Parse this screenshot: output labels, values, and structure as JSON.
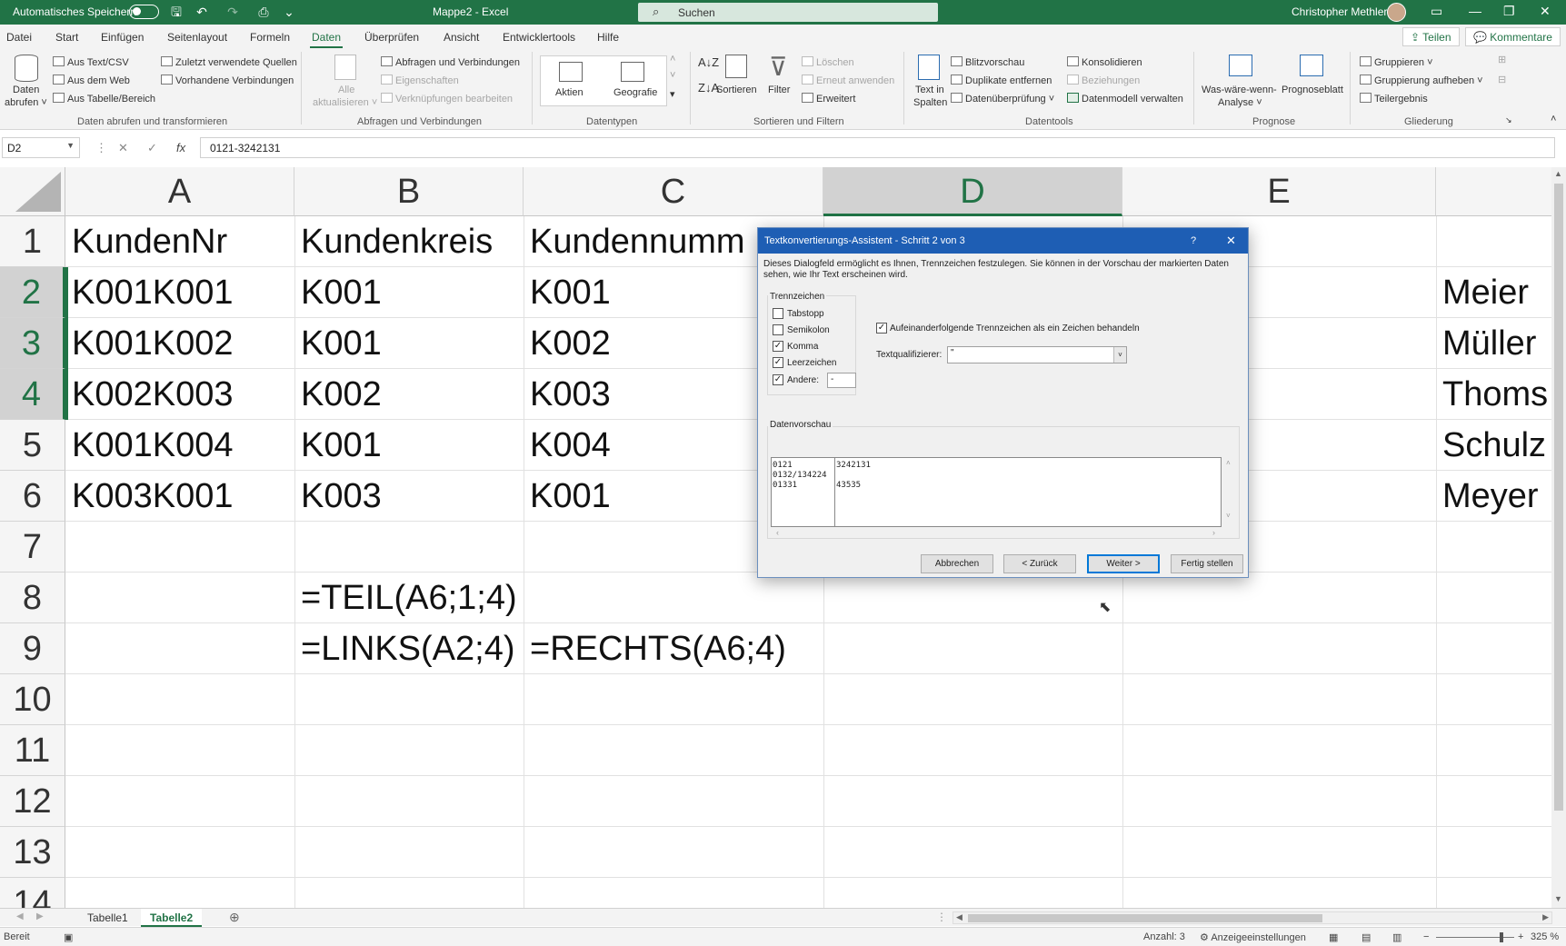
{
  "titlebar": {
    "autosave_label": "Automatisches Speichern",
    "doc_title": "Mappe2  -  Excel",
    "search_placeholder": "Suchen",
    "user": "Christopher Methler"
  },
  "menu": {
    "tabs": [
      "Datei",
      "Start",
      "Einfügen",
      "Seitenlayout",
      "Formeln",
      "Daten",
      "Überprüfen",
      "Ansicht",
      "Entwicklertools",
      "Hilfe"
    ],
    "active": "Daten",
    "share": "Teilen",
    "comments": "Kommentare"
  },
  "ribbon": {
    "get_data": {
      "btn_line1": "Daten",
      "btn_line2": "abrufen ˅",
      "items": [
        "Aus Text/CSV",
        "Aus dem Web",
        "Aus Tabelle/Bereich",
        "Zuletzt verwendete Quellen",
        "Vorhandene Verbindungen"
      ],
      "group": "Daten abrufen und transformieren"
    },
    "queries": {
      "refresh_line1": "Alle",
      "refresh_line2": "aktualisieren ˅",
      "items": [
        "Abfragen und Verbindungen",
        "Eigenschaften",
        "Verknüpfungen bearbeiten"
      ],
      "group": "Abfragen und Verbindungen"
    },
    "datatypes": {
      "items": [
        "Aktien",
        "Geografie"
      ],
      "group": "Datentypen"
    },
    "sort": {
      "sort": "Sortieren",
      "filter": "Filter",
      "items": [
        "Löschen",
        "Erneut anwenden",
        "Erweitert"
      ],
      "group": "Sortieren und Filtern"
    },
    "tools": {
      "text_to_cols_line1": "Text in",
      "text_to_cols_line2": "Spalten",
      "items": [
        "Blitzvorschau",
        "Duplikate entfernen",
        "Datenüberprüfung  ˅",
        "Konsolidieren",
        "Beziehungen",
        "Datenmodell verwalten"
      ],
      "group": "Datentools"
    },
    "forecast": {
      "whatif_line1": "Was-wäre-wenn-",
      "whatif_line2": "Analyse ˅",
      "sheet": "Prognoseblatt",
      "group": "Prognose"
    },
    "outline": {
      "items": [
        "Gruppieren  ˅",
        "Gruppierung aufheben  ˅",
        "Teilergebnis"
      ],
      "group": "Gliederung"
    }
  },
  "formula_bar": {
    "name_box": "D2",
    "formula": "0121-3242131"
  },
  "grid": {
    "columns": [
      "A",
      "B",
      "C",
      "D",
      "E"
    ],
    "selected_col": "D",
    "rows": [
      "1",
      "2",
      "3",
      "4",
      "5",
      "6",
      "7",
      "8",
      "9",
      "10",
      "11",
      "12",
      "13",
      "14"
    ],
    "selected_rows": [
      "2",
      "3",
      "4"
    ],
    "cells": {
      "A1": "KundenNr",
      "B1": "Kundenkreis",
      "C1": "Kundennumm",
      "A2": "K001K001",
      "B2": "K001",
      "C2": "K001",
      "F2": "Meier",
      "A3": "K001K002",
      "B3": "K001",
      "C3": "K002",
      "F3": "Müller",
      "A4": "K002K003",
      "B4": "K002",
      "C4": "K003",
      "F4": "Thoms",
      "A5": "K001K004",
      "B5": "K001",
      "C5": "K004",
      "F5": "Schulz",
      "A6": "K003K001",
      "B6": "K003",
      "C6": "K001",
      "F6": "Meyer",
      "B8": "=TEIL(A6;1;4)",
      "B9": "=LINKS(A2;4)",
      "C9": "=RECHTS(A6;4)"
    }
  },
  "dialog": {
    "title": "Textkonvertierungs-Assistent - Schritt 2 von 3",
    "help": "?",
    "description": "Dieses Dialogfeld ermöglicht es Ihnen, Trennzeichen festzulegen. Sie können in der Vorschau der markierten Daten sehen, wie Ihr Text erscheinen wird.",
    "delimiters_legend": "Trennzeichen",
    "delimiters": [
      {
        "label": "Tabstopp",
        "checked": false
      },
      {
        "label": "Semikolon",
        "checked": false
      },
      {
        "label": "Komma",
        "checked": true
      },
      {
        "label": "Leerzeichen",
        "checked": true
      },
      {
        "label": "Andere:",
        "checked": true
      }
    ],
    "other_value": "-",
    "consecutive_label": "Aufeinanderfolgende Trennzeichen als ein Zeichen behandeln",
    "consecutive_checked": true,
    "qualifier_label": "Textqualifizierer:",
    "qualifier_value": "\"",
    "preview_legend": "Datenvorschau",
    "preview_col1": [
      "0121",
      "0132/134224",
      "01331"
    ],
    "preview_col2": [
      "3242131",
      "",
      "43535"
    ],
    "buttons": {
      "cancel": "Abbrechen",
      "back": "< Zurück",
      "next": "Weiter >",
      "finish": "Fertig stellen"
    }
  },
  "sheets": {
    "tabs": [
      "Tabelle1",
      "Tabelle2"
    ],
    "active": "Tabelle2"
  },
  "status": {
    "mode": "Bereit",
    "count": "Anzahl: 3",
    "display_settings": "Anzeigeeinstellungen",
    "zoom": "325 %"
  }
}
